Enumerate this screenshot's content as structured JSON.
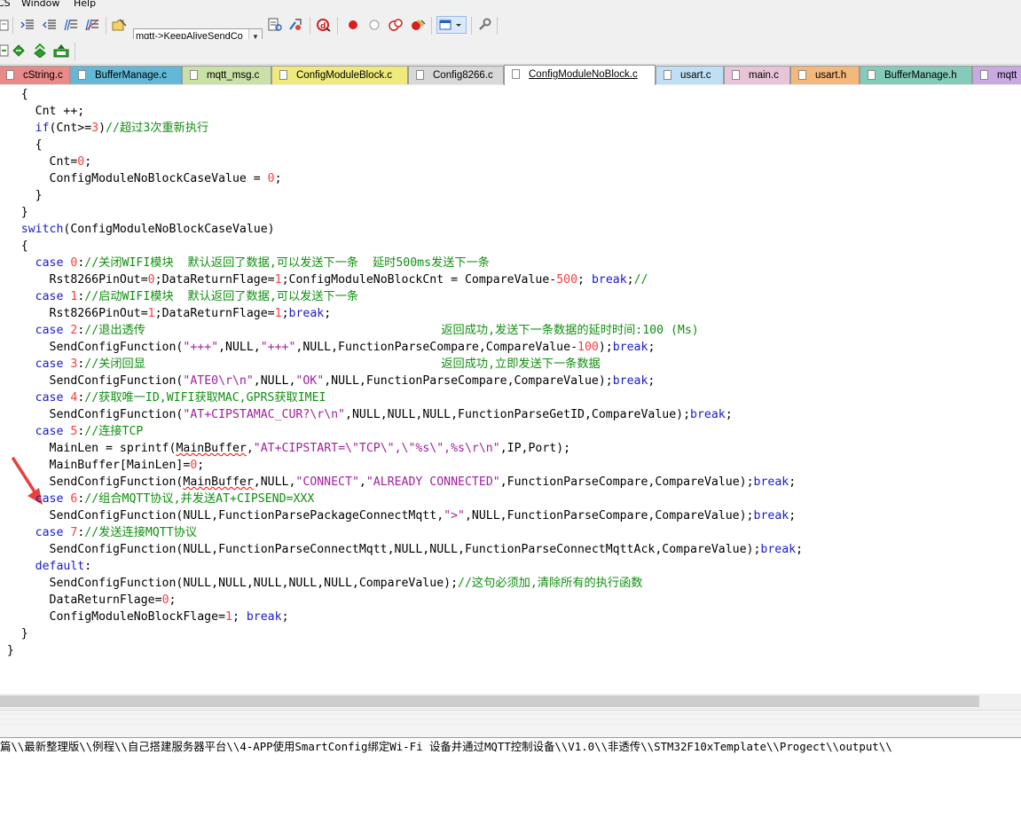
{
  "menu": [
    "CS",
    "Window",
    "Help"
  ],
  "toolbar": {
    "target_combo": "mqtt->KeepAliveSendCo"
  },
  "tabs": [
    {
      "label": "cString.c",
      "color": "#e88a88"
    },
    {
      "label": "BufferManage.c",
      "color": "#62b8d6"
    },
    {
      "label": "mqtt_msg.c",
      "color": "#c9e0a6"
    },
    {
      "label": "ConfigModuleBlock.c",
      "color": "#f0ea7c"
    },
    {
      "label": "Config8266.c",
      "color": "#d8d8d8"
    },
    {
      "label": "ConfigModuleNoBlock.c",
      "color": "#ffffff",
      "active": true
    },
    {
      "label": "usart.c",
      "color": "#bfe0f4"
    },
    {
      "label": "main.c",
      "color": "#e8c4d8"
    },
    {
      "label": "usart.h",
      "color": "#f4b77c"
    },
    {
      "label": "BufferManage.h",
      "color": "#84cbb9"
    },
    {
      "label": "mqtt",
      "color": "#c8a9e4"
    }
  ],
  "code_lines": [
    "    {",
    "      Cnt ++;",
    "      if(Cnt>=3)//超过3次重新执行",
    "      {",
    "        Cnt=0;",
    "        ConfigModuleNoBlockCaseValue = 0;",
    "      }",
    "    }",
    "    switch(ConfigModuleNoBlockCaseValue)",
    "    {",
    "      case 0://关闭WIFI模块  默认返回了数据,可以发送下一条  延时500ms发送下一条",
    "        Rst8266PinOut=0;DataReturnFlage=1;ConfigModuleNoBlockCnt = CompareValue-500; break;//",
    "      case 1://启动WIFI模块  默认返回了数据,可以发送下一条",
    "        Rst8266PinOut=1;DataReturnFlage=1;break;",
    "      case 2://退出透传                                          返回成功,发送下一条数据的延时时间:100 (Ms)",
    "        SendConfigFunction(\"+++\",NULL,\"+++\",NULL,FunctionParseCompare,CompareValue-100);break;",
    "      case 3://关闭回显                                          返回成功,立即发送下一条数据",
    "        SendConfigFunction(\"ATE0\\r\\n\",NULL,\"OK\",NULL,FunctionParseCompare,CompareValue);break;",
    "      case 4://获取唯一ID,WIFI获取MAC,GPRS获取IMEI",
    "        SendConfigFunction(\"AT+CIPSTAMAC_CUR?\\r\\n\",NULL,NULL,NULL,FunctionParseGetID,CompareValue);break;",
    "      case 5://连接TCP",
    "        MainLen = sprintf(MainBuffer,\"AT+CIPSTART=\\\"TCP\\\",\\\"%s\\\",%s\\r\\n\",IP,Port);",
    "        MainBuffer[MainLen]=0;",
    "        SendConfigFunction(MainBuffer,NULL,\"CONNECT\",\"ALREADY CONNECTED\",FunctionParseCompare,CompareValue);break;",
    "      case 6://组合MQTT协议,并发送AT+CIPSEND=XXX",
    "        SendConfigFunction(NULL,FunctionParsePackageConnectMqtt,\">\",NULL,FunctionParseCompare,CompareValue);break;",
    "      case 7://发送连接MQTT协议",
    "        SendConfigFunction(NULL,FunctionParseConnectMqtt,NULL,NULL,FunctionParseConnectMqttAck,CompareValue);break;",
    "      default:",
    "        SendConfigFunction(NULL,NULL,NULL,NULL,NULL,CompareValue);//这句必须加,清除所有的执行函数",
    "        DataReturnFlage=0;",
    "        ConfigModuleNoBlockFlage=1; break;",
    "    }",
    "  }"
  ],
  "output_text": "篇\\\\最新整理版\\\\例程\\\\自己搭建服务器平台\\\\4-APP使用SmartConfig绑定Wi-Fi 设备并通过MQTT控制设备\\\\V1.0\\\\非透传\\\\STM32F10xTemplate\\\\Progect\\\\output\\\\",
  "colors": {
    "keyword": "#1a1acc",
    "number": "#ff3b3b",
    "string": "#a0209e",
    "comment": "#109010",
    "arrow": "#e8403a"
  }
}
